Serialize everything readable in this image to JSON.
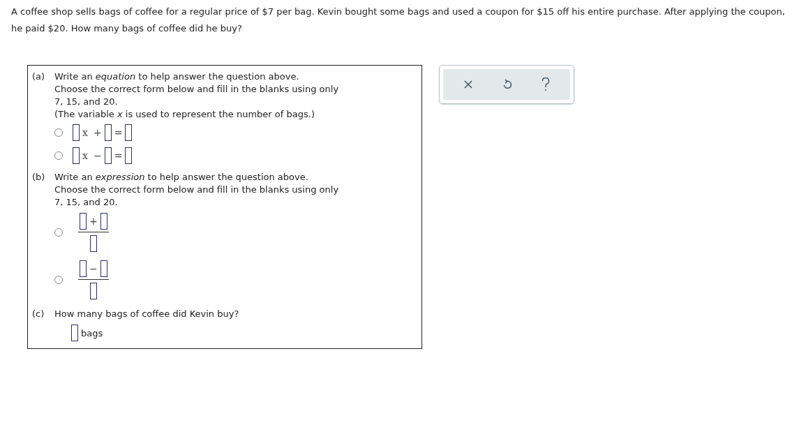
{
  "question": "A coffee shop sells bags of coffee for a regular price of $7 per bag. Kevin bought some bags and used a coupon for $15 off his entire purchase. After applying the coupon, he paid $20. How many bags of coffee did he buy?",
  "parts": [
    {
      "label": "(a)",
      "lines": [
        "Write an *equation* to help answer the question above.",
        "Choose the correct form below and fill in the blanks using only",
        "7, 15, and 20.",
        "(The variable *x* is used to represent the number of bags.)"
      ],
      "options": [
        {
          "kind": "linear",
          "variable": "x",
          "operator": "+",
          "equals": "=",
          "selected": false
        },
        {
          "kind": "linear",
          "variable": "x",
          "operator": "−",
          "equals": "=",
          "selected": false
        }
      ]
    },
    {
      "label": "(b)",
      "lines": [
        "Write an *expression* to help answer the question above.",
        "Choose the correct form below and fill in the blanks using only",
        "7, 15, and 20."
      ],
      "options": [
        {
          "kind": "fraction",
          "operator": "+",
          "selected": false
        },
        {
          "kind": "fraction",
          "operator": "−",
          "selected": false
        }
      ]
    },
    {
      "label": "(c)",
      "lines": [
        "How many bags of coffee did Kevin buy?"
      ],
      "answer": {
        "unit": "bags"
      }
    }
  ]
}
